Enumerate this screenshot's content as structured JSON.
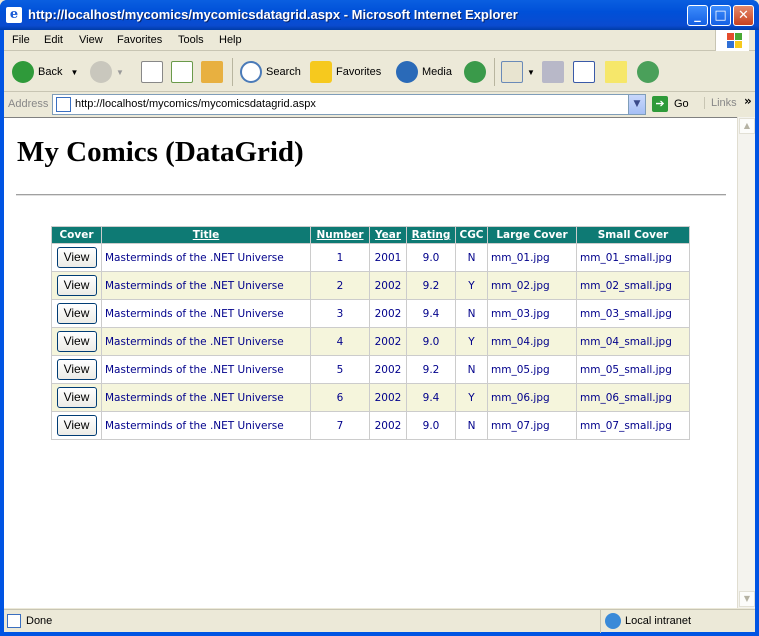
{
  "window": {
    "title": "http://localhost/mycomics/mycomicsdatagrid.aspx - Microsoft Internet Explorer"
  },
  "menu": [
    "File",
    "Edit",
    "View",
    "Favorites",
    "Tools",
    "Help"
  ],
  "toolbar": {
    "back": "Back",
    "search": "Search",
    "favorites": "Favorites",
    "media": "Media"
  },
  "address": {
    "label": "Address",
    "url": "http://localhost/mycomics/mycomicsdatagrid.aspx",
    "go": "Go",
    "links": "Links"
  },
  "page": {
    "heading": "My Comics (DataGrid)",
    "columns": [
      "Cover",
      "Title",
      "Number",
      "Year",
      "Rating",
      "CGC",
      "Large Cover",
      "Small Cover"
    ],
    "view_label": "View",
    "rows": [
      {
        "title": "Masterminds of the .NET Universe",
        "number": "1",
        "year": "2001",
        "rating": "9.0",
        "cgc": "N",
        "large": "mm_01.jpg",
        "small": "mm_01_small.jpg"
      },
      {
        "title": "Masterminds of the .NET Universe",
        "number": "2",
        "year": "2002",
        "rating": "9.2",
        "cgc": "Y",
        "large": "mm_02.jpg",
        "small": "mm_02_small.jpg"
      },
      {
        "title": "Masterminds of the .NET Universe",
        "number": "3",
        "year": "2002",
        "rating": "9.4",
        "cgc": "N",
        "large": "mm_03.jpg",
        "small": "mm_03_small.jpg"
      },
      {
        "title": "Masterminds of the .NET Universe",
        "number": "4",
        "year": "2002",
        "rating": "9.0",
        "cgc": "Y",
        "large": "mm_04.jpg",
        "small": "mm_04_small.jpg"
      },
      {
        "title": "Masterminds of the .NET Universe",
        "number": "5",
        "year": "2002",
        "rating": "9.2",
        "cgc": "N",
        "large": "mm_05.jpg",
        "small": "mm_05_small.jpg"
      },
      {
        "title": "Masterminds of the .NET Universe",
        "number": "6",
        "year": "2002",
        "rating": "9.4",
        "cgc": "Y",
        "large": "mm_06.jpg",
        "small": "mm_06_small.jpg"
      },
      {
        "title": "Masterminds of the .NET Universe",
        "number": "7",
        "year": "2002",
        "rating": "9.0",
        "cgc": "N",
        "large": "mm_07.jpg",
        "small": "mm_07_small.jpg"
      }
    ]
  },
  "status": {
    "text": "Done",
    "zone": "Local intranet"
  },
  "colors": {
    "header_bg": "#0e7a74",
    "alt_row": "#f5f5dc",
    "cell_text": "#00008b",
    "titlebar": "#0054e3"
  },
  "icons": [
    "ie-logo-icon",
    "back-arrow-icon",
    "forward-arrow-icon",
    "stop-icon",
    "refresh-icon",
    "home-icon",
    "search-icon",
    "favorites-star-icon",
    "media-icon",
    "history-icon",
    "mail-icon",
    "print-icon",
    "edit-icon",
    "discuss-icon",
    "messenger-icon",
    "go-arrow-icon",
    "page-icon",
    "intranet-icon"
  ]
}
